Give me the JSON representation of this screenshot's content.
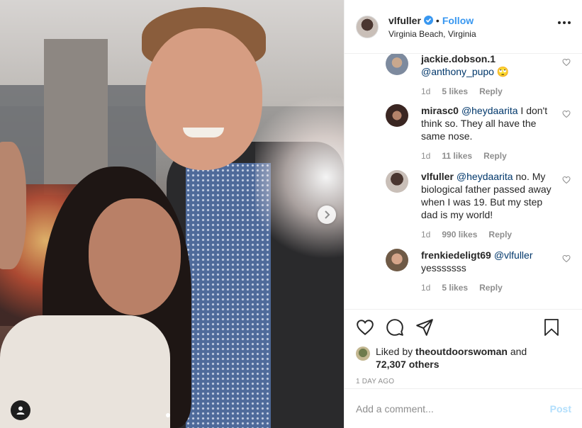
{
  "post": {
    "username": "vlfuller",
    "separator": "•",
    "follow_label": "Follow",
    "location": "Virginia Beach, Virginia"
  },
  "comments": [
    {
      "user": "jackie.dobson.1",
      "mention": "@anthony_pupo",
      "text": " 🙄",
      "time": "1d",
      "likes": "5 likes",
      "reply": "Reply",
      "avatar_color": "#7d8a9e"
    },
    {
      "user": "mirasc0",
      "mention": "@heydaarita",
      "text": " I don't think so. They all have the same nose.",
      "time": "1d",
      "likes": "11 likes",
      "reply": "Reply",
      "avatar_color": "#3a2622"
    },
    {
      "user": "vlfuller",
      "mention": "@heydaarita",
      "text": " no. My biological father passed away when I was 19. But my step dad is my world!",
      "time": "1d",
      "likes": "990 likes",
      "reply": "Reply",
      "avatar_color": "#4a3630"
    },
    {
      "user": "frenkiedeligt69",
      "mention": "@vlfuller",
      "text": " yesssssss",
      "time": "1d",
      "likes": "5 likes",
      "reply": "Reply",
      "avatar_color": "#6f5a46"
    }
  ],
  "likes": {
    "prefix": "Liked by",
    "user": "theoutdoorswoman",
    "and": "and",
    "count": "72,307 others"
  },
  "time_ago": "1 DAY AGO",
  "add_comment": {
    "placeholder": "Add a comment...",
    "post_label": "Post"
  },
  "colors": {
    "accent": "#3897f0",
    "mention": "#00376b",
    "muted": "#8e8e8e",
    "post_disabled": "#b2dffc"
  },
  "icons": {
    "next": "chevron-right-icon",
    "tag": "user-tag-icon",
    "like": "heart-icon",
    "comment": "comment-icon",
    "share": "share-icon",
    "save": "bookmark-icon",
    "verified": "verified-badge-icon",
    "more": "more-options-icon"
  }
}
